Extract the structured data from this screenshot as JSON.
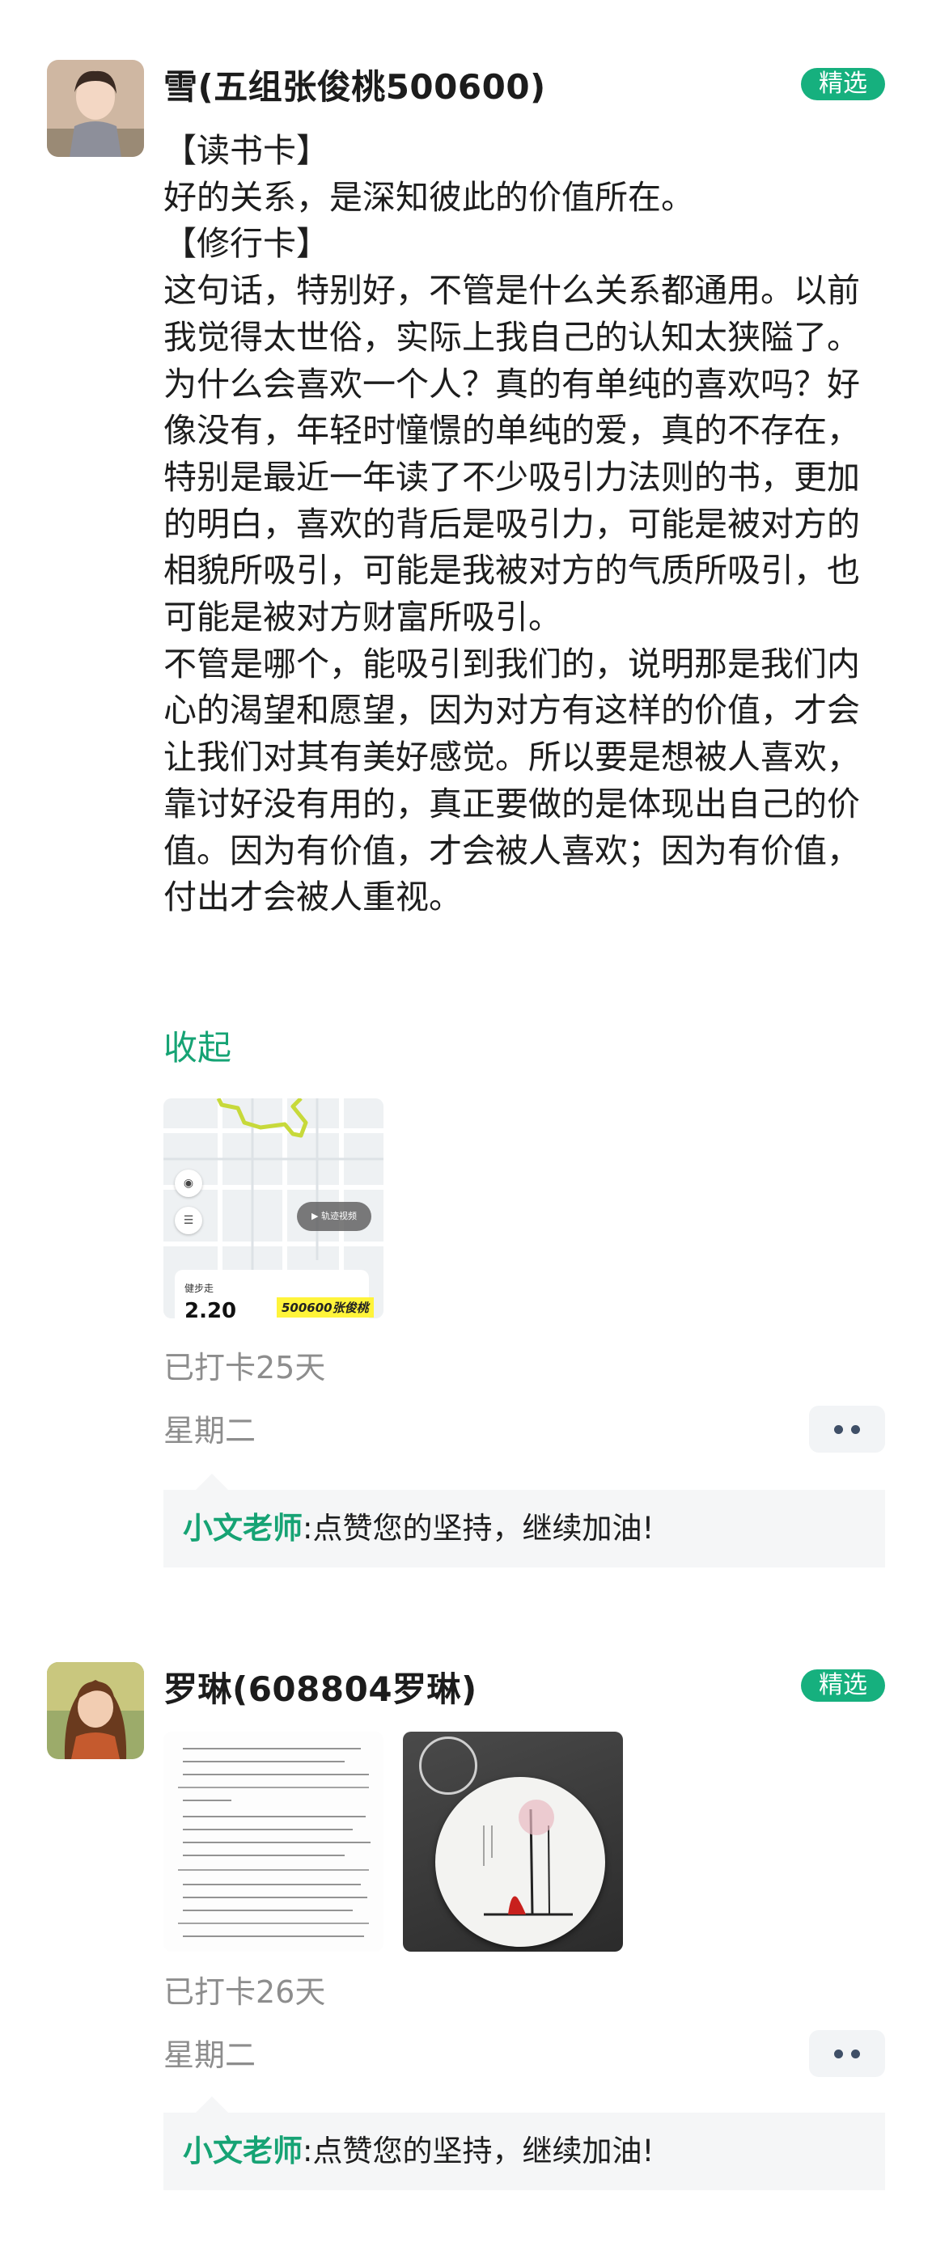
{
  "posts": [
    {
      "username": "雪(五组张俊桃500600)",
      "badge": "精选",
      "content": [
        "【读书卡】",
        "好的关系，是深知彼此的价值所在。",
        "【修行卡】",
        "这句话，特别好，不管是什么关系都通用。以前我觉得太世俗，实际上我自己的认知太狭隘了。",
        "为什么会喜欢一个人？真的有单纯的喜欢吗？好像没有，年轻时憧憬的单纯的爱，真的不存在，特别是最近一年读了不少吸引力法则的书，更加的明白，喜欢的背后是吸引力，可能是被对方的相貌所吸引，可能是我被对方的气质所吸引，也可能是被对方财富所吸引。",
        "不管是哪个，能吸引到我们的，说明那是我们内心的渴望和愿望，因为对方有这样的价值，才会让我们对其有美好感觉。所以要是想被人喜欢，靠讨好没有用的，真正要做的是体现出自己的价值。因为有价值，才会被人喜欢；因为有价值，付出才会被人重视。"
      ],
      "collapse_label": "收起",
      "map_thumb": {
        "card_label": "健步走",
        "card_value": "2.20",
        "overlay_text": "500600张俊桃",
        "play_label": "▶ 轨迹视频"
      },
      "checkin": "已打卡25天",
      "weekday": "星期二",
      "comment": {
        "author": "小文老师",
        "sep": ":",
        "text": "点赞您的坚持，继续加油!"
      }
    },
    {
      "username": "罗琳(608804罗琳)",
      "badge": "精选",
      "checkin": "已打卡26天",
      "weekday": "星期二",
      "comment": {
        "author": "小文老师",
        "sep": ":",
        "text": "点赞您的坚持，继续加油!"
      }
    }
  ],
  "colors": {
    "accent": "#16b07e",
    "link": "#16a374",
    "meta": "#8d8d8d",
    "comment_bg": "#f5f6f7"
  },
  "icons": [
    "more-dots-icon",
    "eye-icon",
    "layers-icon",
    "play-icon"
  ]
}
